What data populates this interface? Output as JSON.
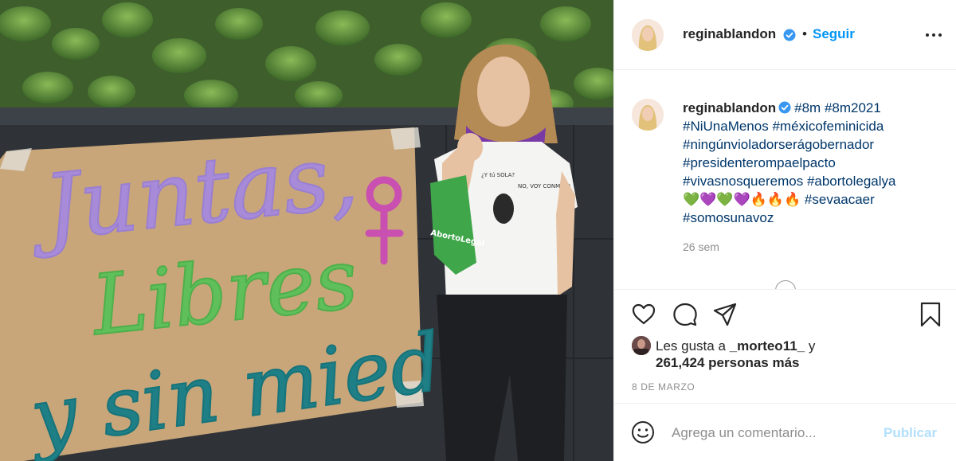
{
  "photo": {
    "sign_text": [
      "Juntas,",
      "Libres",
      "y sin miedo"
    ],
    "shirt_text": [
      "¿Y tú SOLA?",
      "NO, VOY CONMIGO"
    ],
    "scarf_text": "AbortoLegal"
  },
  "header": {
    "username": "reginablandon",
    "separator": "•",
    "follow_label": "Seguir"
  },
  "caption": {
    "username": "reginablandon",
    "lines": [
      [
        "#8m",
        "#8m2021"
      ],
      [
        "#NiUnaMenos",
        "#méxicofeminicida"
      ],
      [
        "#ningúnvioladorserágobernador"
      ],
      [
        "#presidenterompaelpacto"
      ],
      [
        "#vivasnosqueremos",
        "#abortolegalya"
      ]
    ],
    "emoji_line": "💚💜💚💜🔥🔥🔥",
    "emoji_tag": "#sevaacaer",
    "last_tag": "#somosunavoz",
    "time_ago": "26 sem"
  },
  "likes": {
    "prefix": "Les gusta a ",
    "user": "_morteo11_",
    "conj": " y",
    "count": "261,424 personas más"
  },
  "date": "8 DE MARZO",
  "comment": {
    "placeholder": "Agrega un comentario...",
    "publish_label": "Publicar"
  },
  "colors": {
    "link_blue": "#0095f6",
    "hashtag": "#00376b",
    "muted": "#8e8e8e",
    "publish_disabled": "#b2dffc"
  }
}
